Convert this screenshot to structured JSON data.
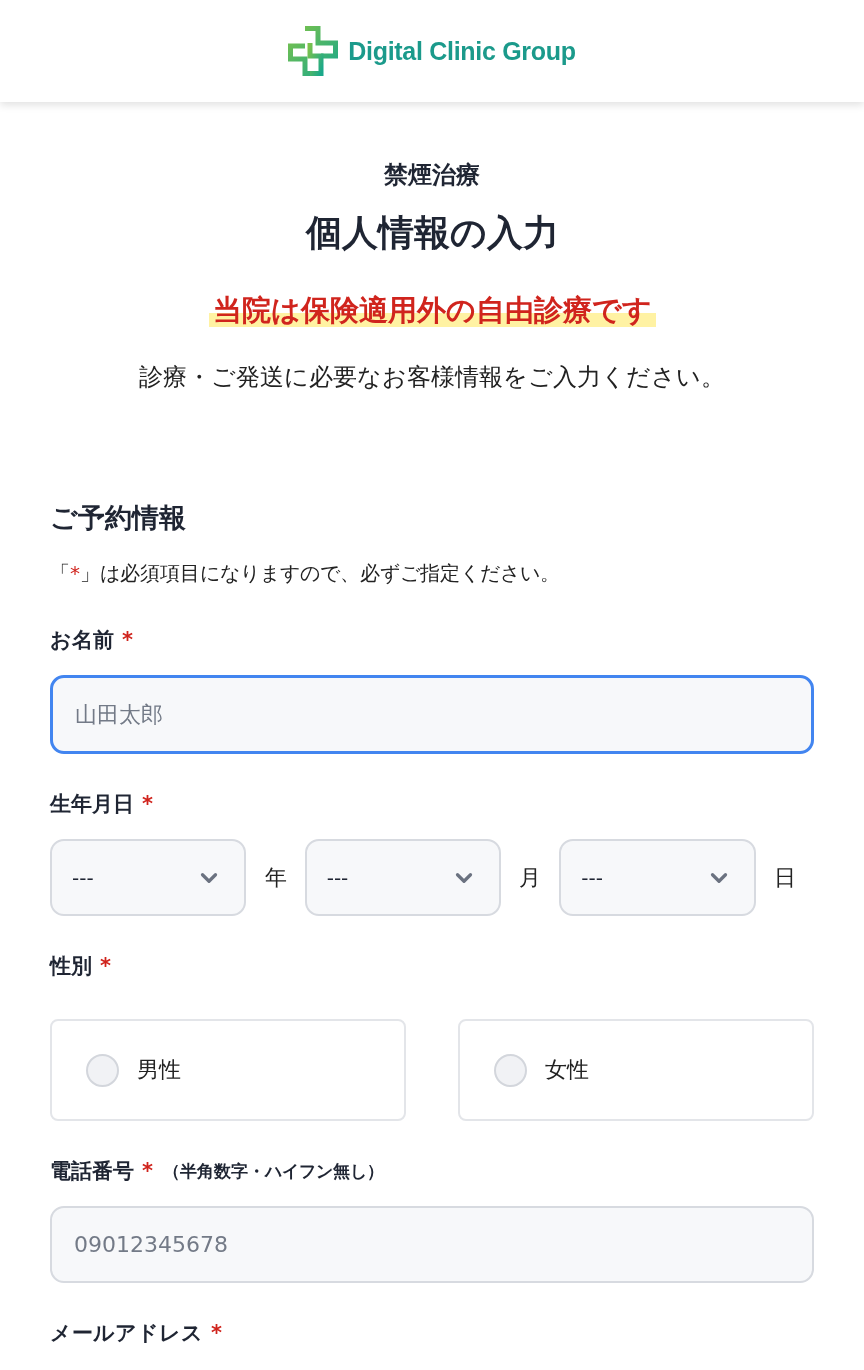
{
  "header": {
    "logo_text": "Digital Clinic Group"
  },
  "intro": {
    "category": "禁煙治療",
    "title": "個人情報の入力",
    "notice": "当院は保険適用外の自由診療です",
    "description": "診療・ご発送に必要なお客様情報をご入力ください。"
  },
  "section": {
    "title": "ご予約情報",
    "note": {
      "prefix": "「",
      "mark": "*",
      "suffix": "」は必須項目になりますので、必ずご指定ください。"
    }
  },
  "fields": [
    {
      "kind": "text",
      "label": "お名前",
      "required_mark": "*",
      "placeholder": "山田太郎",
      "focused": true
    },
    {
      "kind": "date",
      "label": "生年月日",
      "required_mark": "*",
      "selects": [
        {
          "value": "---",
          "unit": "年"
        },
        {
          "value": "---",
          "unit": "月"
        },
        {
          "value": "---",
          "unit": "日"
        }
      ]
    },
    {
      "kind": "radio",
      "label": "性別",
      "required_mark": "*",
      "options": [
        {
          "label": "男性",
          "selected": false
        },
        {
          "label": "女性",
          "selected": false
        }
      ]
    },
    {
      "kind": "text",
      "label": "電話番号",
      "required_mark": "*",
      "hint": "（半角数字・ハイフン無し）",
      "placeholder": "09012345678",
      "focused": false
    },
    {
      "kind": "label",
      "label": "メールアドレス",
      "required_mark": "*"
    }
  ]
}
